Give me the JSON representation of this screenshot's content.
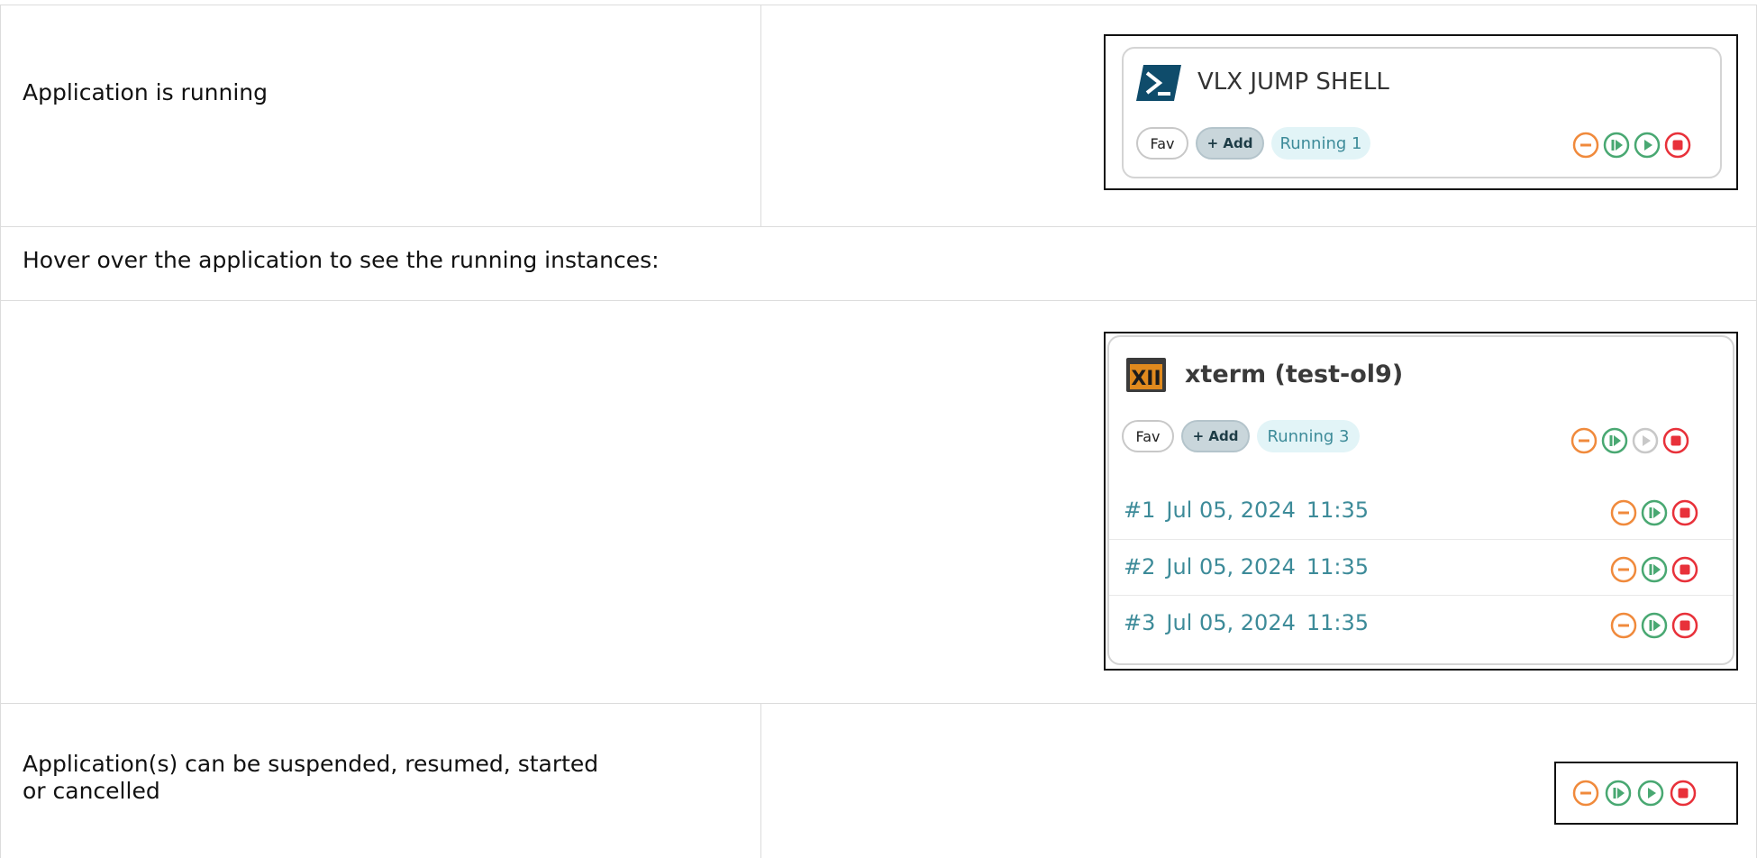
{
  "rows": [
    {
      "label": "Application is running"
    },
    {
      "label": "Hover over the application to see the running instances:"
    },
    {
      "label": ""
    },
    {
      "label_line1": "Application(s) can be suspended, resumed, started",
      "label_line2": "or cancelled"
    }
  ],
  "card1": {
    "title": "VLX JUMP SHELL",
    "fav_label": "Fav",
    "add_label": "+ Add",
    "running_label": "Running 1"
  },
  "card2": {
    "title": "xterm (test-ol9)",
    "fav_label": "Fav",
    "add_label": "+ Add",
    "running_label": "Running 3",
    "instances": [
      {
        "num": "#1",
        "date": "Jul 05, 2024",
        "time": "11:35"
      },
      {
        "num": "#2",
        "date": "Jul 05, 2024",
        "time": "11:35"
      },
      {
        "num": "#3",
        "date": "Jul 05, 2024",
        "time": "11:35"
      }
    ]
  },
  "colors": {
    "suspend": "#f08a3c",
    "resume": "#49a872",
    "start": "#49a872",
    "start_disabled": "#c8c8c8",
    "cancel": "#e8313a",
    "running_text": "#3d8b99"
  },
  "icons": {
    "suspend": "minus-circle-icon",
    "resume": "resume-circle-icon",
    "start": "play-circle-icon",
    "cancel": "stop-circle-icon",
    "powershell": "powershell-icon",
    "x11": "x11-icon"
  }
}
